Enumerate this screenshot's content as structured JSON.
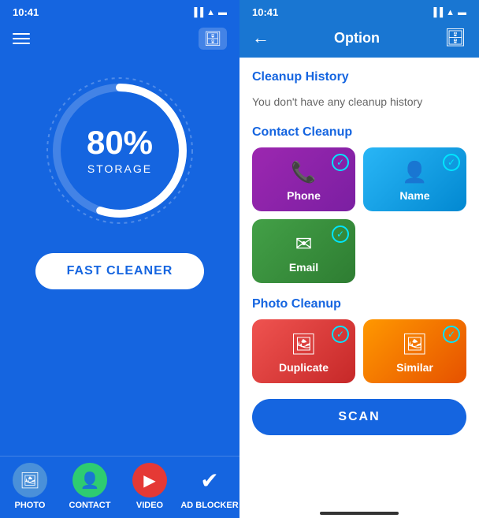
{
  "left": {
    "time": "10:41",
    "header_icon": "☰",
    "storage_percent": "80%",
    "storage_label": "STORAGE",
    "fast_cleaner_btn": "FAST CLEANER",
    "nav": [
      {
        "label": "PHOTO",
        "icon": "🖼",
        "type": "photo"
      },
      {
        "label": "CONTACT",
        "icon": "👤",
        "type": "contact"
      },
      {
        "label": "VIDEO",
        "icon": "▶",
        "type": "video"
      },
      {
        "label": "AD BLOCKER",
        "icon": "✓",
        "type": "adblocker"
      }
    ]
  },
  "right": {
    "time": "10:41",
    "title": "Option",
    "back": "←",
    "cleanup_history_title": "Cleanup History",
    "empty_history": "You don't have any cleanup history",
    "contact_cleanup_title": "Contact Cleanup",
    "photo_cleanup_title": "Photo Cleanup",
    "cards": [
      {
        "id": "phone",
        "label": "Phone",
        "icon": "📞",
        "color_class": "phone"
      },
      {
        "id": "name",
        "label": "Name",
        "icon": "👤",
        "color_class": "name"
      },
      {
        "id": "email",
        "label": "Email",
        "icon": "✉",
        "color_class": "email"
      },
      {
        "id": "duplicate",
        "label": "Duplicate",
        "icon": "🖼",
        "color_class": "duplicate"
      },
      {
        "id": "similar",
        "label": "Similar",
        "icon": "🖼",
        "color_class": "similar"
      }
    ],
    "scan_btn": "SCAN"
  },
  "colors": {
    "accent": "#1565e0",
    "white": "#ffffff"
  }
}
